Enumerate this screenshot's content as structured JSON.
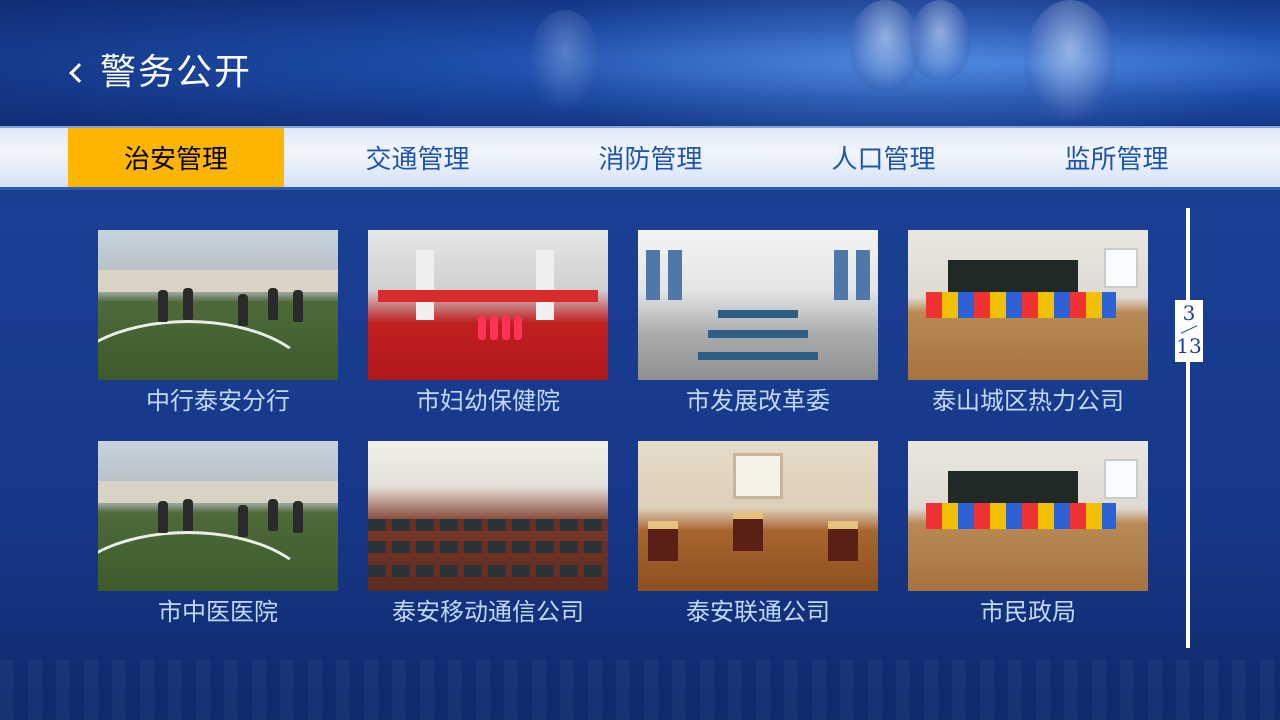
{
  "header": {
    "title": "警务公开",
    "back_icon": "chevron-left-icon"
  },
  "nav": {
    "active_color": "#FEB500",
    "text_color": "#4E74B8",
    "tabs": [
      {
        "label": "治安管理",
        "active": true
      },
      {
        "label": "交通管理",
        "active": false
      },
      {
        "label": "消防管理",
        "active": false
      },
      {
        "label": "人口管理",
        "active": false
      },
      {
        "label": "监所管理",
        "active": false
      }
    ]
  },
  "grid": {
    "label_color": "#C2D8FB",
    "items": [
      {
        "label": "中行泰安分行",
        "image": "sports-field"
      },
      {
        "label": "市妇幼保健院",
        "image": "stage-performance"
      },
      {
        "label": "市发展改革委",
        "image": "table-tennis-hall"
      },
      {
        "label": "泰山城区热力公司",
        "image": "classroom"
      },
      {
        "label": "市中医医院",
        "image": "sports-field"
      },
      {
        "label": "泰安移动通信公司",
        "image": "conference-room"
      },
      {
        "label": "泰安联通公司",
        "image": "lounge"
      },
      {
        "label": "市民政局",
        "image": "classroom"
      }
    ]
  },
  "pager": {
    "current": "3",
    "total": "13"
  }
}
